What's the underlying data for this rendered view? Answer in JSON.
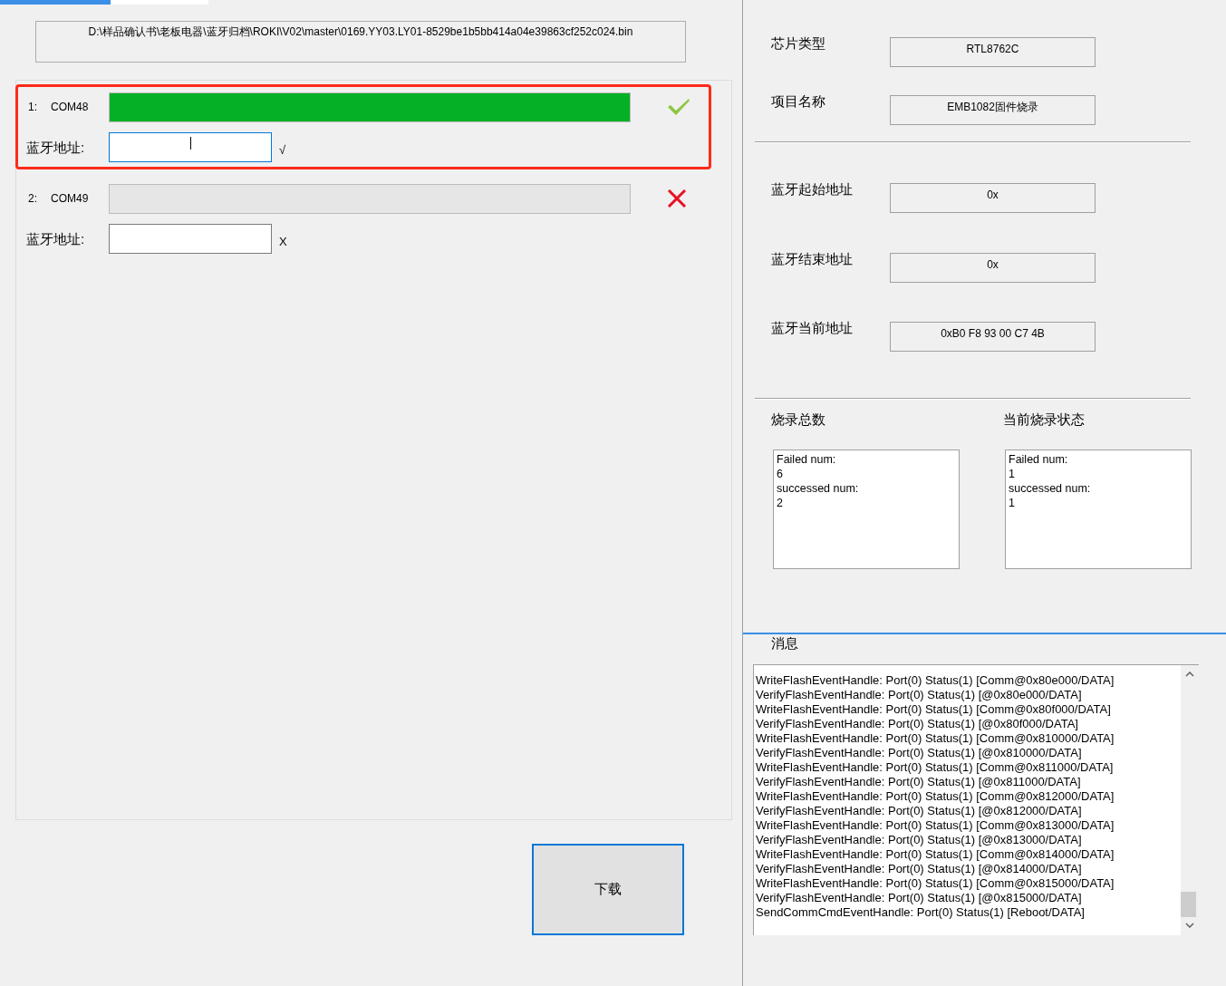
{
  "tabs": [
    {
      "selected": true
    },
    {
      "selected": false
    }
  ],
  "file_path": "D:\\样品确认书\\老板电器\\蓝牙归档\\ROKI\\V02\\master\\0169.YY03.LY01-8529be1b5bb414a04e39863cf252c024.bin",
  "ports": [
    {
      "index": "1:",
      "name": "COM48",
      "highlighted": true,
      "level": 1,
      "passed": true,
      "address_label": "蓝牙地址:",
      "address_focused": true,
      "address_mark": "√"
    },
    {
      "index": "2:",
      "name": "COM49",
      "highlighted": false,
      "level": 0,
      "passed": false,
      "address_label": "蓝牙地址:",
      "address_focused": false,
      "address_mark": "X"
    }
  ],
  "download_button": "下载",
  "chip_fields": [
    {
      "label": "芯片类型",
      "value": "RTL8762C"
    },
    {
      "label": "项目名称",
      "value": "EMB1082固件烧录"
    }
  ],
  "address_fields": [
    {
      "label": "蓝牙起始地址",
      "value": "0x"
    },
    {
      "label": "蓝牙结束地址",
      "value": "0x"
    },
    {
      "label": "蓝牙当前地址",
      "value": "0xB0 F8 93 00 C7 4B"
    }
  ],
  "counters": [
    {
      "title": "烧录总数",
      "lines": [
        "Failed num:",
        "6",
        "successed num:",
        "2"
      ]
    },
    {
      "title": "当前烧录状态",
      "lines": [
        "Failed num:",
        "1",
        "successed num:",
        "1"
      ]
    }
  ],
  "messages": {
    "title": "消息",
    "lines": [
      "WriteFlashEventHandle: Port(0) Status(1) [Comm@0x80e000/DATA]",
      "VerifyFlashEventHandle: Port(0) Status(1) [@0x80e000/DATA]",
      "WriteFlashEventHandle: Port(0) Status(1) [Comm@0x80f000/DATA]",
      "VerifyFlashEventHandle: Port(0) Status(1) [@0x80f000/DATA]",
      "WriteFlashEventHandle: Port(0) Status(1) [Comm@0x810000/DATA]",
      "VerifyFlashEventHandle: Port(0) Status(1) [@0x810000/DATA]",
      "WriteFlashEventHandle: Port(0) Status(1) [Comm@0x811000/DATA]",
      "VerifyFlashEventHandle: Port(0) Status(1) [@0x811000/DATA]",
      "WriteFlashEventHandle: Port(0) Status(1) [Comm@0x812000/DATA]",
      "VerifyFlashEventHandle: Port(0) Status(1) [@0x812000/DATA]",
      "WriteFlashEventHandle: Port(0) Status(1) [Comm@0x813000/DATA]",
      "VerifyFlashEventHandle: Port(0) Status(1) [@0x813000/DATA]",
      "WriteFlashEventHandle: Port(0) Status(1) [Comm@0x814000/DATA]",
      "VerifyFlashEventHandle: Port(0) Status(1) [@0x814000/DATA]",
      "WriteFlashEventHandle: Port(0) Status(1) [Comm@0x815000/DATA]",
      "VerifyFlashEventHandle: Port(0) Status(1) [@0x815000/DATA]",
      "SendCommCmdEventHandle: Port(0) Status(1) [Reboot/DATA]"
    ]
  }
}
